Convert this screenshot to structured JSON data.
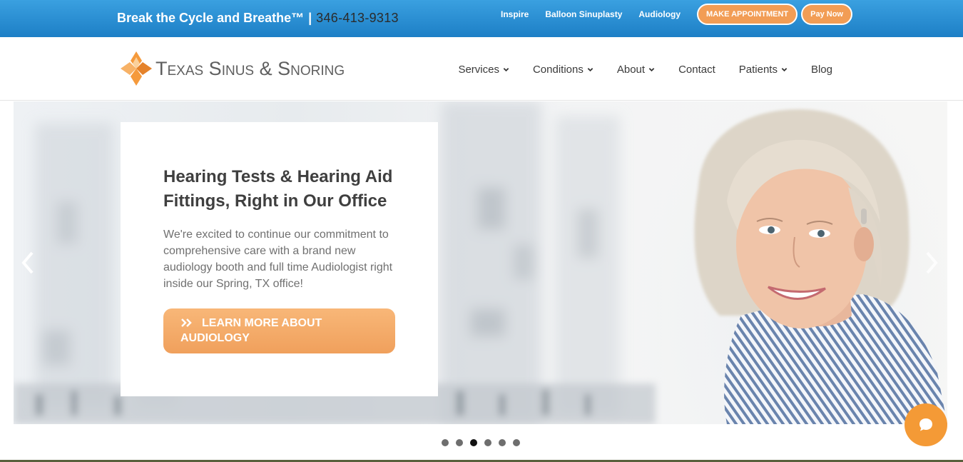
{
  "topbar": {
    "tagline": "Break the Cycle and Breathe™",
    "separator": "|",
    "phone": "346-413-9313",
    "links": [
      "Inspire",
      "Balloon Sinuplasty",
      "Audiology"
    ],
    "appointment_button": "MAKE APPOINTMENT",
    "pay_button": "Pay Now",
    "colors": {
      "bar": "#2a8fd4",
      "button": "#f29d55"
    }
  },
  "header": {
    "logo_text": "Texas Sinus & Snoring",
    "nav": [
      {
        "label": "Services",
        "dropdown": true
      },
      {
        "label": "Conditions",
        "dropdown": true
      },
      {
        "label": "About",
        "dropdown": true
      },
      {
        "label": "Contact",
        "dropdown": false
      },
      {
        "label": "Patients",
        "dropdown": true
      },
      {
        "label": "Blog",
        "dropdown": false
      }
    ]
  },
  "hero": {
    "title": "Hearing Tests & Hearing Aid Fittings, Right in Our Office",
    "body": "We're excited to continue our commitment to comprehensive care with a brand new audiology booth and full time Audiologist right inside our Spring, TX office!",
    "cta_label": "LEARN MORE ABOUT AUDIOLOGY",
    "cta_icon": "double-chevron-right-icon",
    "prev_icon": "chevron-left-icon",
    "next_icon": "chevron-right-icon",
    "image": "smiling-woman-with-hearing-aid",
    "accent": "#f0a05c"
  },
  "carousel": {
    "slides": 6,
    "active_index": 2
  },
  "chat": {
    "icon": "chat-bubble-icon",
    "color": "#f49a36"
  }
}
